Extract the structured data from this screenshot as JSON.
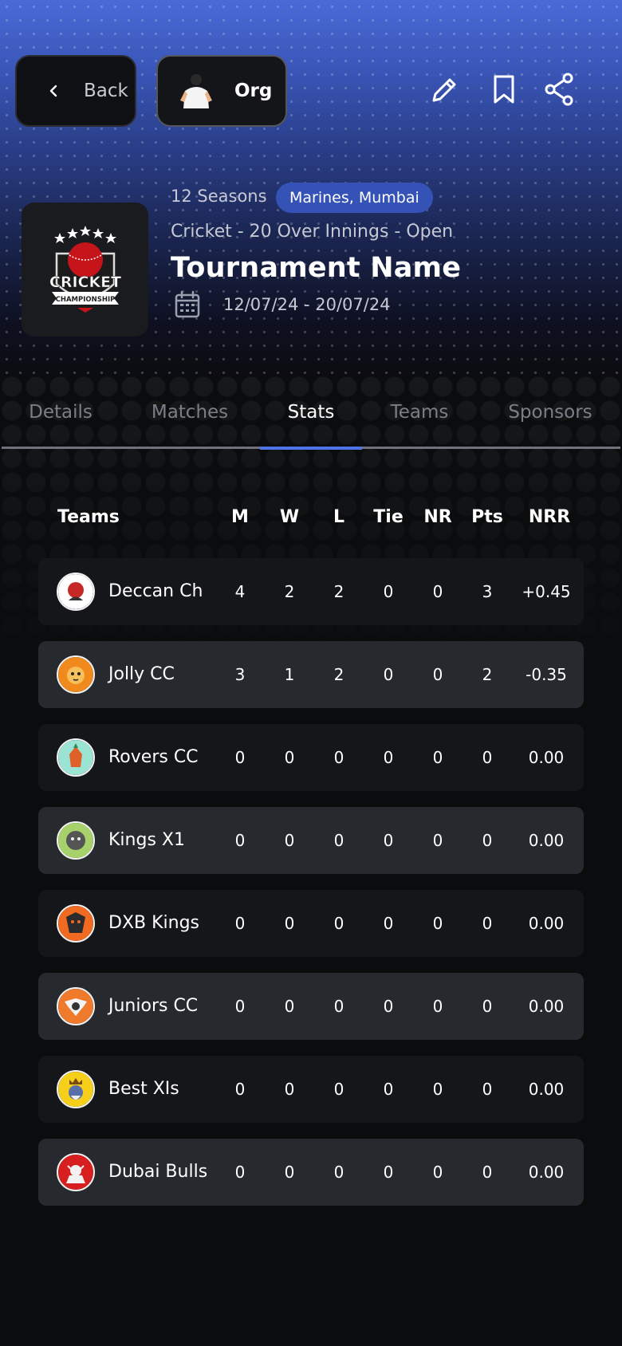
{
  "header": {
    "back_label": "Back",
    "org_label": "Org",
    "edit_icon": "pencil-icon",
    "bookmark_icon": "bookmark-icon",
    "share_icon": "share-icon"
  },
  "tournament": {
    "seasons": "12 Seasons",
    "location": "Marines, Mumbai",
    "format": "Cricket - 20 Over Innings - Open",
    "name": "Tournament Name",
    "dates": "12/07/24 - 20/07/24",
    "logo": {
      "word": "CRICKET",
      "ribbon": "CHAMPIONSHIP"
    }
  },
  "tabs": [
    {
      "label": "Details",
      "active": false
    },
    {
      "label": "Matches",
      "active": false
    },
    {
      "label": "Stats",
      "active": true
    },
    {
      "label": "Teams",
      "active": false
    },
    {
      "label": "Sponsors",
      "active": false
    }
  ],
  "table": {
    "headers": {
      "teams": "Teams",
      "m": "M",
      "w": "W",
      "l": "L",
      "tie": "Tie",
      "nr": "NR",
      "pts": "Pts",
      "nrr": "NRR"
    },
    "rows": [
      {
        "name": "Deccan Ch",
        "m": "4",
        "w": "2",
        "l": "2",
        "tie": "0",
        "nr": "0",
        "pts": "3",
        "nrr": "+0.45",
        "logo_color": "#ffffff"
      },
      {
        "name": "Jolly CC",
        "m": "3",
        "w": "1",
        "l": "2",
        "tie": "0",
        "nr": "0",
        "pts": "2",
        "nrr": "-0.35",
        "logo_color": "#f08a1c"
      },
      {
        "name": "Rovers CC",
        "m": "0",
        "w": "0",
        "l": "0",
        "tie": "0",
        "nr": "0",
        "pts": "0",
        "nrr": "0.00",
        "logo_color": "#9be3d2"
      },
      {
        "name": "Kings X1",
        "m": "0",
        "w": "0",
        "l": "0",
        "tie": "0",
        "nr": "0",
        "pts": "0",
        "nrr": "0.00",
        "logo_color": "#a7d16a"
      },
      {
        "name": "DXB Kings",
        "m": "0",
        "w": "0",
        "l": "0",
        "tie": "0",
        "nr": "0",
        "pts": "0",
        "nrr": "0.00",
        "logo_color": "#f06a22"
      },
      {
        "name": "Juniors CC",
        "m": "0",
        "w": "0",
        "l": "0",
        "tie": "0",
        "nr": "0",
        "pts": "0",
        "nrr": "0.00",
        "logo_color": "#f07a2c"
      },
      {
        "name": "Best XIs",
        "m": "0",
        "w": "0",
        "l": "0",
        "tie": "0",
        "nr": "0",
        "pts": "0",
        "nrr": "0.00",
        "logo_color": "#f5cf1a"
      },
      {
        "name": "Dubai Bulls",
        "m": "0",
        "w": "0",
        "l": "0",
        "tie": "0",
        "nr": "0",
        "pts": "0",
        "nrr": "0.00",
        "logo_color": "#d81f1f"
      }
    ]
  }
}
